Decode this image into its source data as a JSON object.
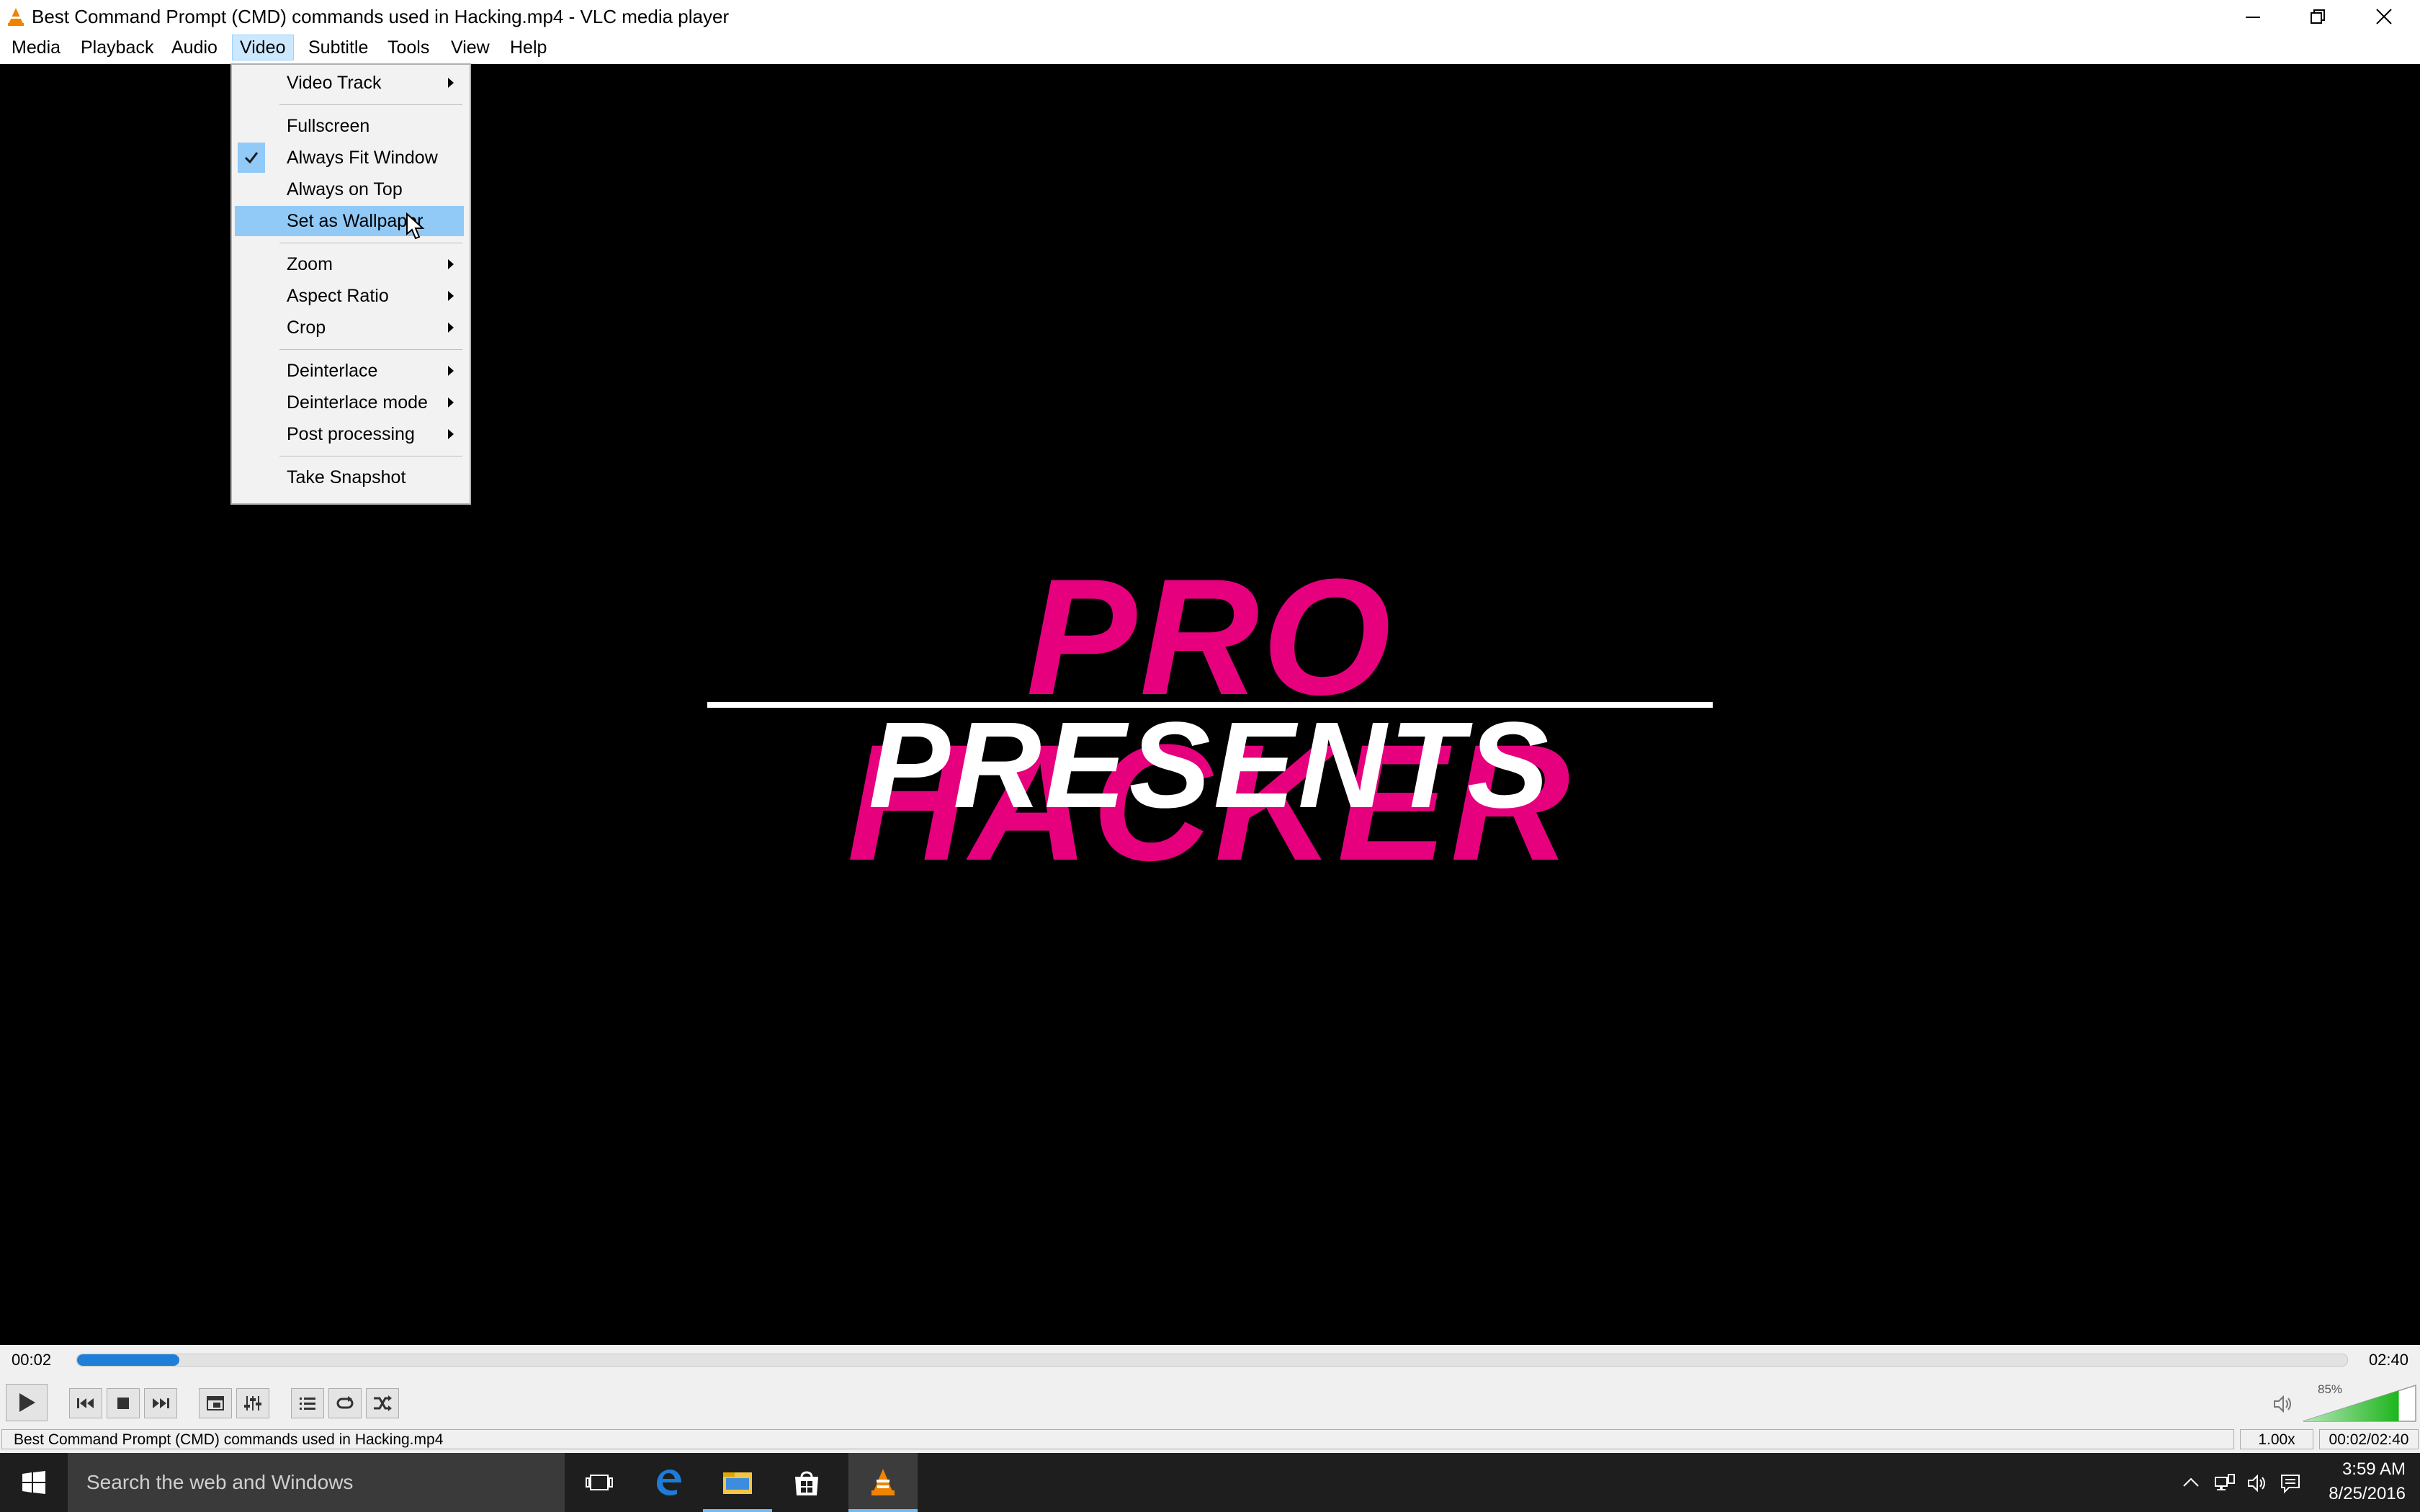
{
  "window": {
    "title": "Best Command Prompt (CMD) commands used in Hacking.mp4 - VLC media player"
  },
  "menubar": {
    "items": [
      "Media",
      "Playback",
      "Audio",
      "Video",
      "Subtitle",
      "Tools",
      "View",
      "Help"
    ],
    "open_menu": "Video"
  },
  "video_menu": {
    "items": [
      {
        "label": "Video Track",
        "submenu": true
      },
      {
        "label": "Fullscreen",
        "submenu": false
      },
      {
        "label": "Always Fit Window",
        "submenu": false,
        "checked": true
      },
      {
        "label": "Always on Top",
        "submenu": false
      },
      {
        "label": "Set as Wallpaper",
        "submenu": false,
        "highlighted": true
      },
      {
        "label": "Zoom",
        "submenu": true
      },
      {
        "label": "Aspect Ratio",
        "submenu": true
      },
      {
        "label": "Crop",
        "submenu": true
      },
      {
        "label": "Deinterlace",
        "submenu": true
      },
      {
        "label": "Deinterlace mode",
        "submenu": true
      },
      {
        "label": "Post processing",
        "submenu": true
      },
      {
        "label": "Take Snapshot",
        "submenu": false
      }
    ]
  },
  "video_frame": {
    "line1": "PRO HACKER",
    "line2": "PRESENTS",
    "line1_color": "#e6007e",
    "line2_color": "#ffffff"
  },
  "playback": {
    "elapsed": "00:02",
    "total": "02:40",
    "progress": 0.0125,
    "volume_label": "85%",
    "volume": 0.85
  },
  "controls": {
    "icons": [
      "play-icon",
      "previous-icon",
      "stop-icon",
      "next-icon",
      "fullscreen-icon",
      "extended-settings-icon",
      "playlist-icon",
      "loop-icon",
      "shuffle-icon"
    ]
  },
  "status": {
    "filename": "Best Command Prompt (CMD) commands used in Hacking.mp4",
    "speed": "1.00x",
    "time": "00:02/02:40"
  },
  "taskbar": {
    "search_placeholder": "Search the web and Windows",
    "clock_time": "3:59 AM",
    "clock_date": "8/25/2016",
    "apps": [
      "task-view-icon",
      "edge-icon",
      "file-explorer-icon",
      "store-icon",
      "vlc-icon"
    ]
  },
  "colors": {
    "accent": "#1f7fd8",
    "menu_highlight": "#91c9f7",
    "vlc_orange": "#f08300"
  }
}
